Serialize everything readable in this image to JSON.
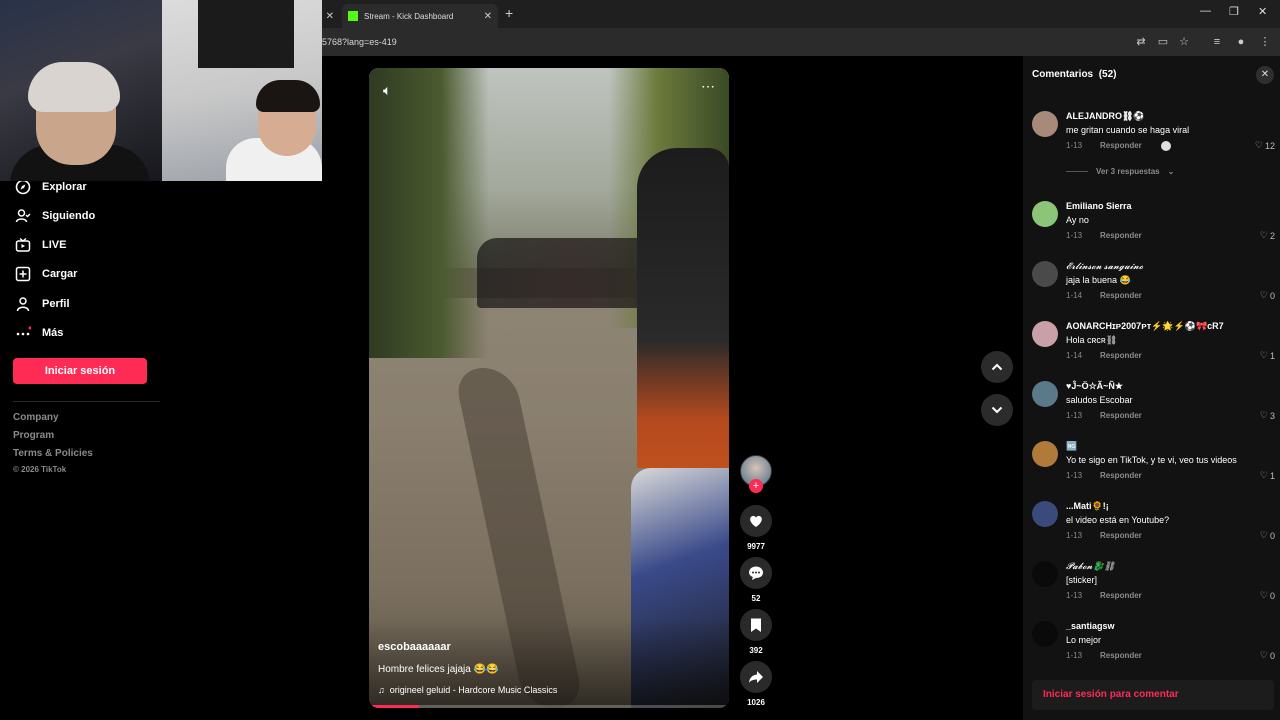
{
  "browser": {
    "tab_partial_label": "",
    "tab_kick_label": "Stream - Kick Dashboard",
    "url_text": "5768?lang=es-419"
  },
  "sidebar": {
    "items": [
      {
        "label": "Explorar",
        "icon": "compass-icon"
      },
      {
        "label": "Siguiendo",
        "icon": "following-icon"
      },
      {
        "label": "LIVE",
        "icon": "live-icon"
      },
      {
        "label": "Cargar",
        "icon": "upload-icon"
      },
      {
        "label": "Perfil",
        "icon": "profile-icon"
      },
      {
        "label": "Más",
        "icon": "more-icon"
      }
    ],
    "login_label": "Iniciar sesión",
    "footer": {
      "company": "Company",
      "program": "Program",
      "terms": "Terms & Policies",
      "copyright": "© 2026 TikTok"
    }
  },
  "video": {
    "username": "escobaaaaaar",
    "description": "Hombre felices jajaja 😂😂",
    "music": "originееl geluid - Hardcore Music Classics",
    "progress_fraction": 0.14,
    "likes": "9977",
    "comments": "52",
    "saves": "392",
    "shares": "1026"
  },
  "comments_panel": {
    "title": "Comentarios",
    "count": "(52)",
    "view_replies": "Ver 3 respuestas",
    "reply_label": "Responder",
    "login_to_comment": "Iniciar sesión para comentar",
    "items": [
      {
        "name": "ALEJANDRO⛓⚽",
        "text": "me gritan cuando se haga viral",
        "date": "1-13",
        "likes": "12",
        "avatar_color": "#a88a7a"
      },
      {
        "name": "Emiliano Sierra",
        "text": "Ay no",
        "date": "1-13",
        "likes": "2",
        "avatar_color": "#8cc47a"
      },
      {
        "name": "𝓔𝓻𝓵𝓲𝓷𝓼𝓸𝓷 𝓼𝓪𝓷𝓰𝓾𝓲𝓷𝓸",
        "text": "jaja la buena 😂",
        "date": "1-14",
        "likes": "0",
        "avatar_color": "#4a4a4a"
      },
      {
        "name": "AONARCHɪᴘ2007ᴘᴛ⚡🌟⚡⚽🎀cR7",
        "text": "Hola ᴄʀᴄʀ⛓",
        "date": "1-14",
        "likes": "1",
        "avatar_color": "#c9a0a8"
      },
      {
        "name": "♥Ĵ~Ö☆Ã~Ñ★",
        "text": "saludos Escobar",
        "date": "1-13",
        "likes": "3",
        "avatar_color": "#5a7a8a"
      },
      {
        "name": "🆖",
        "text": "Yo te sigo en TikTok, y te vi, veo tus videos",
        "date": "1-13",
        "likes": "1",
        "avatar_color": "#b07a3a"
      },
      {
        "name": "...Mati🌻!¡",
        "text": "el video está en Youtube?",
        "date": "1-13",
        "likes": "0",
        "avatar_color": "#3a4a7a"
      },
      {
        "name": "𝓟𝓪𝓫𝓸𝓷🐉⛓",
        "text": "[sticker]",
        "date": "1-13",
        "likes": "0",
        "avatar_color": "#0a0a0a"
      },
      {
        "name": "_santiagsw",
        "text": "Lo mejor",
        "date": "1-13",
        "likes": "0",
        "avatar_color": "#0a0a0a"
      }
    ]
  },
  "colors": {
    "accent": "#fe2c55",
    "panel_bg": "#121212",
    "page_bg": "#000000"
  }
}
